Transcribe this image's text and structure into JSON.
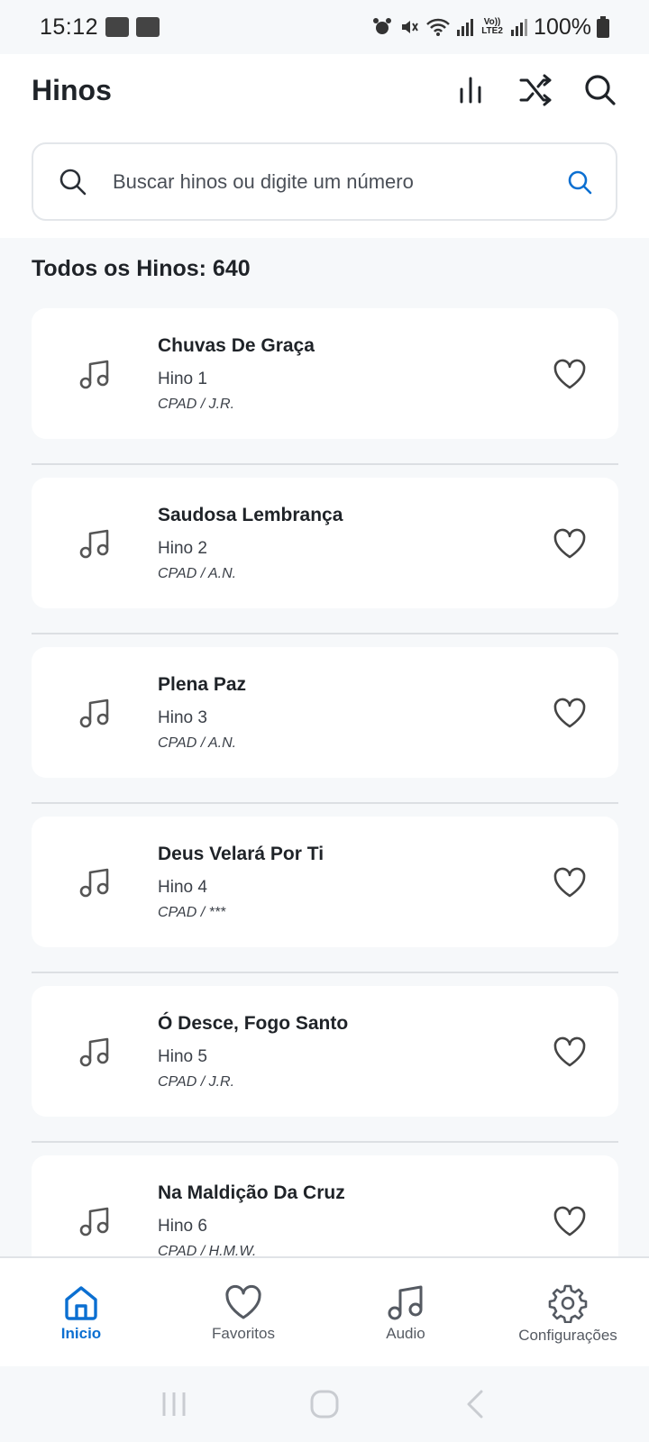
{
  "status_bar": {
    "time": "15:12",
    "battery": "100%",
    "network_label": "Vo)) LTE2"
  },
  "header": {
    "title": "Hinos"
  },
  "search": {
    "placeholder": "Buscar hinos ou digite um número"
  },
  "section": {
    "title": "Todos os Hinos: 640"
  },
  "hymns": [
    {
      "title": "Chuvas De Graça",
      "number": "Hino 1",
      "author": "CPAD / J.R."
    },
    {
      "title": "Saudosa Lembrança",
      "number": "Hino 2",
      "author": "CPAD / A.N."
    },
    {
      "title": "Plena Paz",
      "number": "Hino 3",
      "author": "CPAD / A.N."
    },
    {
      "title": "Deus Velará Por Ti",
      "number": "Hino 4",
      "author": "CPAD / ***"
    },
    {
      "title": "Ó Desce, Fogo Santo",
      "number": "Hino 5",
      "author": "CPAD / J.R."
    },
    {
      "title": "Na Maldição Da Cruz",
      "number": "Hino 6",
      "author": "CPAD / H.M.W."
    }
  ],
  "nav": {
    "items": [
      {
        "label": "Inicio",
        "icon": "home-icon",
        "active": true
      },
      {
        "label": "Favoritos",
        "icon": "heart-icon",
        "active": false
      },
      {
        "label": "Audio",
        "icon": "music-note-icon",
        "active": false
      },
      {
        "label": "Configurações",
        "icon": "gear-icon",
        "active": false
      }
    ]
  },
  "colors": {
    "accent": "#0b6fd1",
    "background": "#f6f8fa",
    "card": "#ffffff"
  }
}
